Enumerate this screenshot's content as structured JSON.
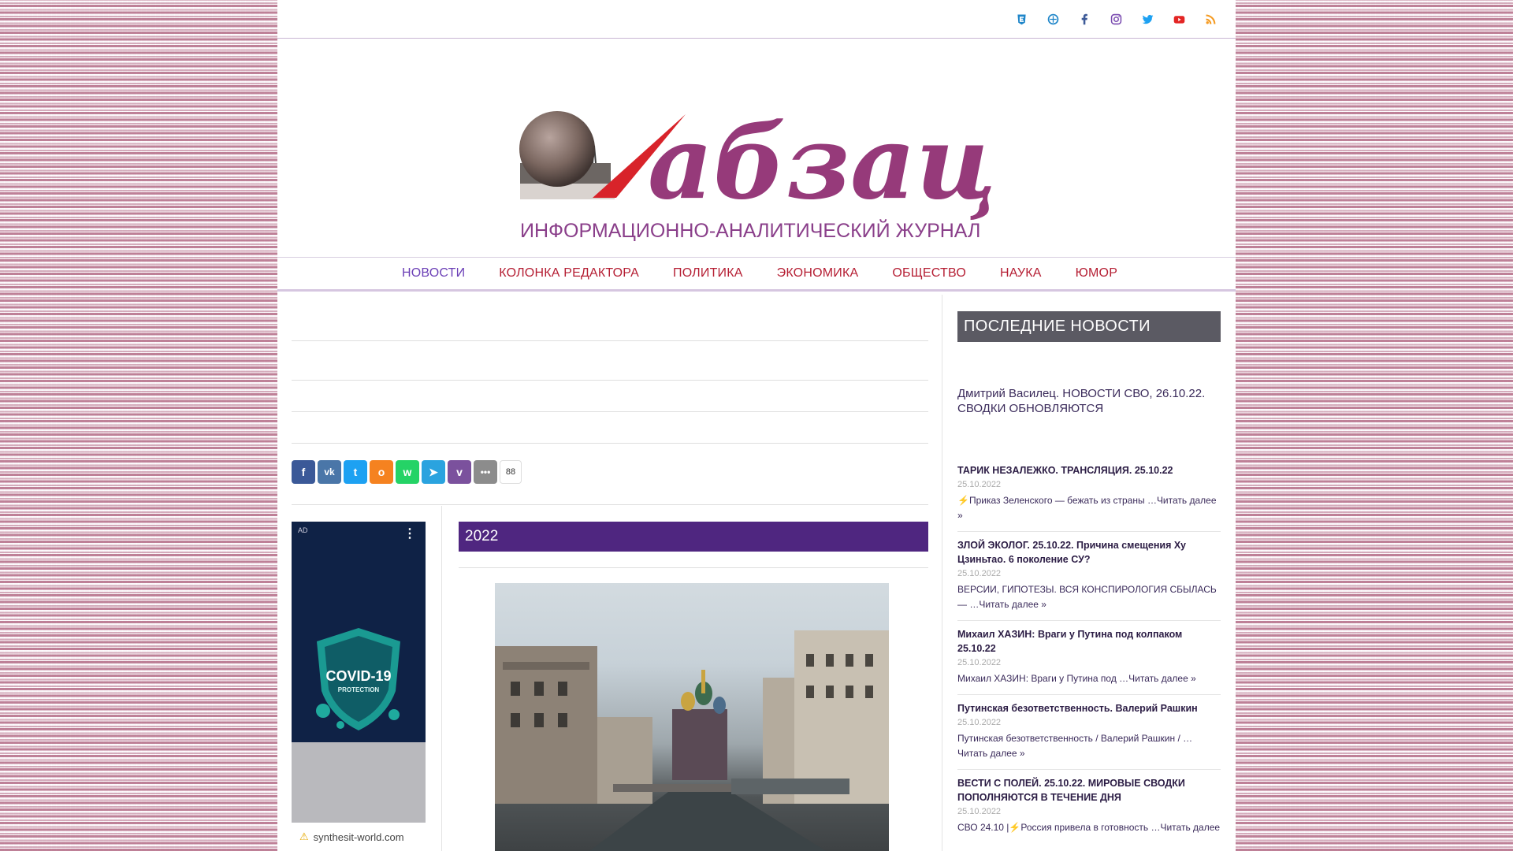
{
  "logo": {
    "wordmark": "абзац",
    "tagline": "ИНФОРМАЦИОННО-АНАЛИТИЧЕСКИЙ ЖУРНАЛ"
  },
  "social_icons": [
    "ulule-icon",
    "vk-network-icon",
    "facebook-icon",
    "instagram-icon",
    "twitter-icon",
    "youtube-icon",
    "rss-icon"
  ],
  "nav": {
    "items": [
      {
        "label": "НОВОСТИ"
      },
      {
        "label": "КОЛОНКА РЕДАКТОРА"
      },
      {
        "label": "ПОЛИТИКА"
      },
      {
        "label": "ЭКОНОМИКА"
      },
      {
        "label": "ОБЩЕСТВО"
      },
      {
        "label": "НАУКА"
      },
      {
        "label": "ЮМОР"
      }
    ]
  },
  "share": {
    "count": "88"
  },
  "ad": {
    "label": "AD",
    "domain": "synthesit-world.com",
    "badge_title": "COVID-19",
    "badge_sub": "PROTECTION"
  },
  "main": {
    "year_title": "2022"
  },
  "sidebar": {
    "title": "ПОСЛЕДНИЕ НОВОСТИ",
    "featured": "Дмитрий Василец. НОВОСТИ СВО, 26.10.22. СВОДКИ ОБНОВЛЯЮТСЯ",
    "items": [
      {
        "title": "ТАРИК НЕЗАЛЕЖКО. ТРАНСЛЯЦИЯ. 25.10.22",
        "date": "25.10.2022",
        "excerpt": "⚡Приказ Зеленского — бежать из страны …Читать далее »"
      },
      {
        "title": "ЗЛОЙ ЭКОЛОГ. 25.10.22. Причина смещения Ху Цзиньтао. 6 поколение СУ?",
        "date": "25.10.2022",
        "excerpt": "ВЕРСИИ, ГИПОТЕЗЫ. ВСЯ КОНСПИРОЛОГИЯ СБЫЛАСЬ — …Читать далее »"
      },
      {
        "title": "Михаил ХАЗИН: Враги у Путина под колпаком 25.10.22",
        "date": "25.10.2022",
        "excerpt": "Михаил ХАЗИН: Враги у Путина под …Читать далее »"
      },
      {
        "title": "Путинская безответственность. Валерий Рашкин",
        "date": "25.10.2022",
        "excerpt": "Путинская безответственность / Валерий Рашкин / … Читать далее »"
      },
      {
        "title": "ВЕСТИ С ПОЛЕЙ. 25.10.22. МИРОВЫЕ СВОДКИ ПОПОЛНЯЮТСЯ В ТЕЧЕНИЕ ДНЯ",
        "date": "25.10.2022",
        "excerpt": "СВО 24.10 |⚡Россия привела в готовность …Читать далее"
      }
    ]
  }
}
